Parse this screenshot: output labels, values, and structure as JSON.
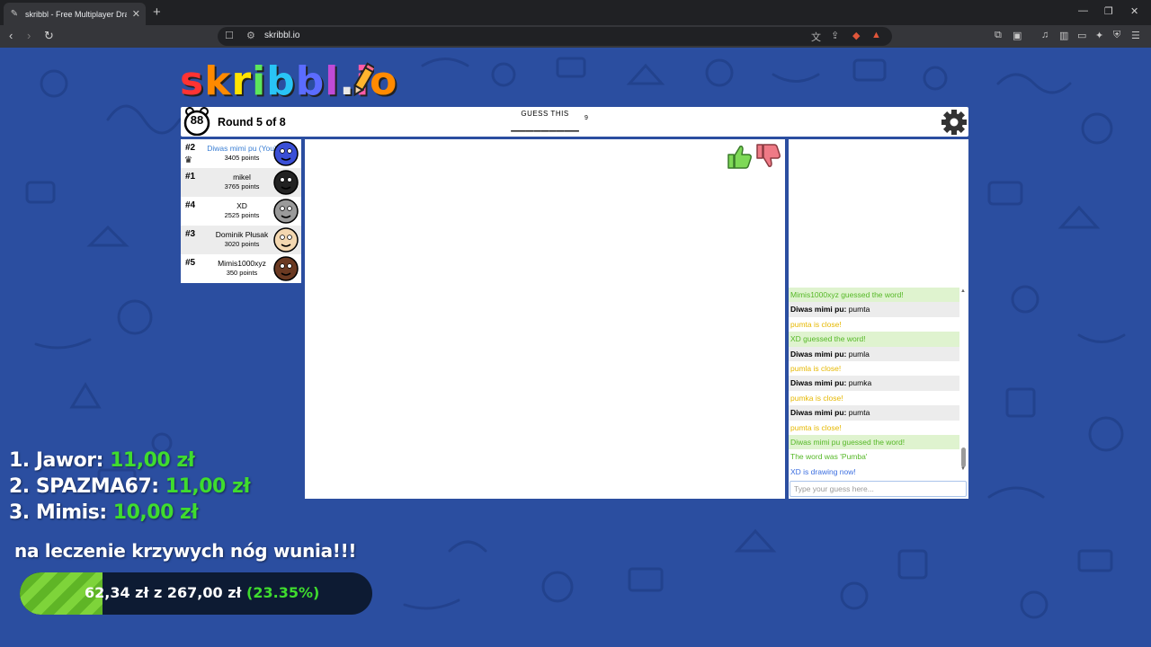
{
  "browser": {
    "tab_title": "skribbl - Free Multiplayer Dra",
    "url": "skribbl.io"
  },
  "game": {
    "logo_text": "skribbl.io",
    "timer": "88",
    "round": "Round 5 of 8",
    "guess_label": "GUESS THIS",
    "word_hint": "_________",
    "word_length": "9"
  },
  "players": [
    {
      "rank": "#2",
      "name": "Diwas mimi pu (You)",
      "points": "3405 points",
      "is_you": true,
      "avatar_color": "#3a4fd6"
    },
    {
      "rank": "#1",
      "name": "mikel",
      "points": "3765 points",
      "is_you": false,
      "avatar_color": "#222222"
    },
    {
      "rank": "#4",
      "name": "XD",
      "points": "2525 points",
      "is_you": false,
      "avatar_color": "#9a9a9a"
    },
    {
      "rank": "#3",
      "name": "Dominik Płusak",
      "points": "3020 points",
      "is_you": false,
      "avatar_color": "#f3d7b0"
    },
    {
      "rank": "#5",
      "name": "Mimis1000xyz",
      "points": "350 points",
      "is_you": false,
      "avatar_color": "#6b3a22"
    }
  ],
  "chat": {
    "messages": [
      {
        "type": "green",
        "author": "",
        "text": "Mimis1000xyz guessed the word!"
      },
      {
        "type": "grey",
        "author": "Diwas mimi pu:",
        "text": " pumta"
      },
      {
        "type": "close",
        "author": "",
        "text": "pumta is close!"
      },
      {
        "type": "green",
        "author": "",
        "text": "XD guessed the word!"
      },
      {
        "type": "grey",
        "author": "Diwas mimi pu:",
        "text": " pumla"
      },
      {
        "type": "close",
        "author": "",
        "text": "pumla is close!"
      },
      {
        "type": "grey",
        "author": "Diwas mimi pu:",
        "text": " pumka"
      },
      {
        "type": "close",
        "author": "",
        "text": "pumka is close!"
      },
      {
        "type": "grey",
        "author": "Diwas mimi pu:",
        "text": " pumta"
      },
      {
        "type": "close",
        "author": "",
        "text": "pumta is close!"
      },
      {
        "type": "green",
        "author": "",
        "text": "Diwas mimi pu guessed the word!"
      },
      {
        "type": "plain-green",
        "author": "",
        "text": "The word was 'Pumba'"
      },
      {
        "type": "blue",
        "author": "",
        "text": "XD is drawing now!"
      }
    ],
    "input_placeholder": "Type your guess here..."
  },
  "overlay": {
    "donors": [
      {
        "label": "1. Jawor:",
        "amount": "11,00 zł"
      },
      {
        "label": "2. SPAZMA67:",
        "amount": "11,00 zł"
      },
      {
        "label": "3. Mimis:",
        "amount": "10,00 zł"
      }
    ],
    "cause": "na leczenie krzywych nóg wunia!!!",
    "progress": {
      "current": "62,34 zł",
      "sep": "z",
      "goal": "267,00 zł",
      "percent_label": "(23.35%)",
      "fraction": 0.2335
    }
  },
  "colors": {
    "page_bg": "#2b4ea0",
    "accent_green": "#3fdc2e",
    "close_yellow": "#e6b800"
  }
}
